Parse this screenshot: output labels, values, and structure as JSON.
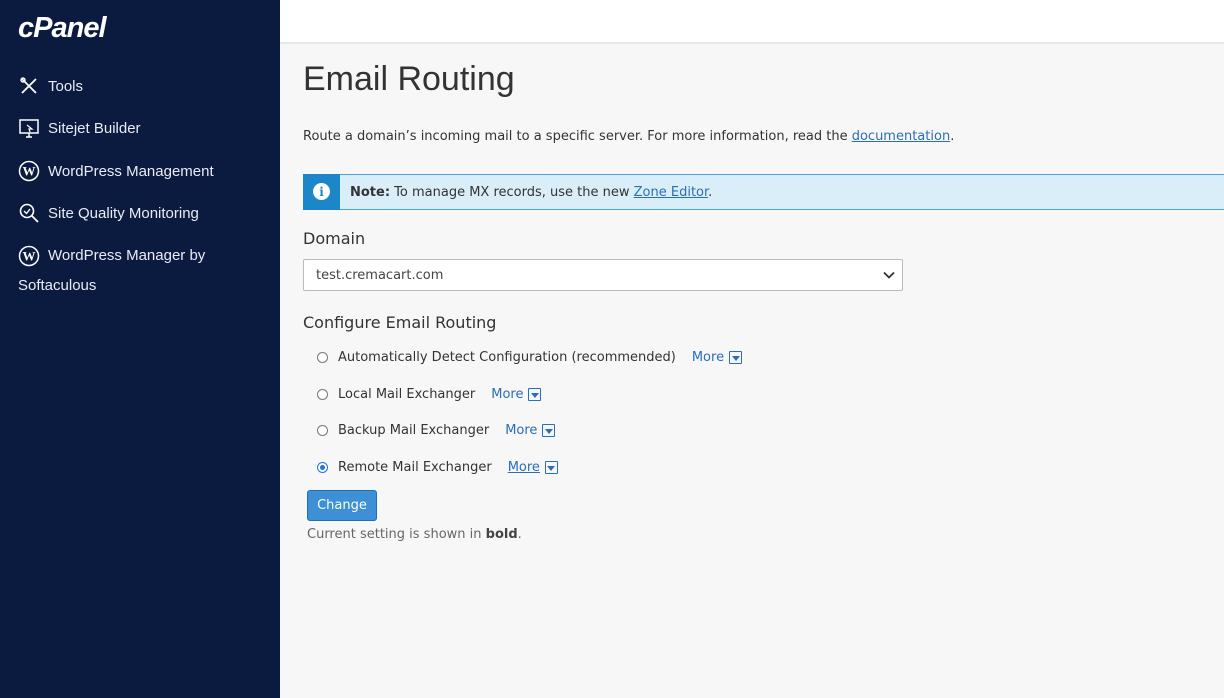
{
  "sidebar": {
    "logo": "cPanel",
    "items": [
      {
        "label": "Tools",
        "icon": "tools-icon"
      },
      {
        "label": "Sitejet Builder",
        "icon": "sitejet-icon"
      },
      {
        "label": "WordPress Management",
        "icon": "wordpress-icon"
      },
      {
        "label": "Site Quality Monitoring",
        "icon": "search-check-icon"
      },
      {
        "label": "WordPress Manager by Softaculous",
        "icon": "wordpress-icon"
      }
    ]
  },
  "main": {
    "title": "Email Routing",
    "intro": {
      "text": "Route a domain’s incoming mail to a specific server. For more information, read the ",
      "link": "documentation",
      "suffix": "."
    },
    "note": {
      "label": "Note:",
      "text": " To manage MX records, use the new ",
      "link": "Zone Editor",
      "suffix": "."
    },
    "domain": {
      "label": "Domain",
      "selected": "test.cremacart.com"
    },
    "configure": {
      "label": "Configure Email Routing",
      "options": [
        {
          "label": "Automatically Detect Configuration (recommended)",
          "more": "More",
          "checked": false
        },
        {
          "label": "Local Mail Exchanger",
          "more": "More",
          "checked": false
        },
        {
          "label": "Backup Mail Exchanger",
          "more": "More",
          "checked": false
        },
        {
          "label": "Remote Mail Exchanger",
          "more": "More",
          "checked": true
        }
      ]
    },
    "change_button": "Change",
    "current_setting": {
      "prefix": "Current setting is shown in ",
      "bold": "bold",
      "suffix": "."
    }
  },
  "colors": {
    "sidebar_bg": "#0b1a3f",
    "accent": "#3d8fd6",
    "link": "#2a6ebb",
    "note_bg": "#d9eef8"
  }
}
